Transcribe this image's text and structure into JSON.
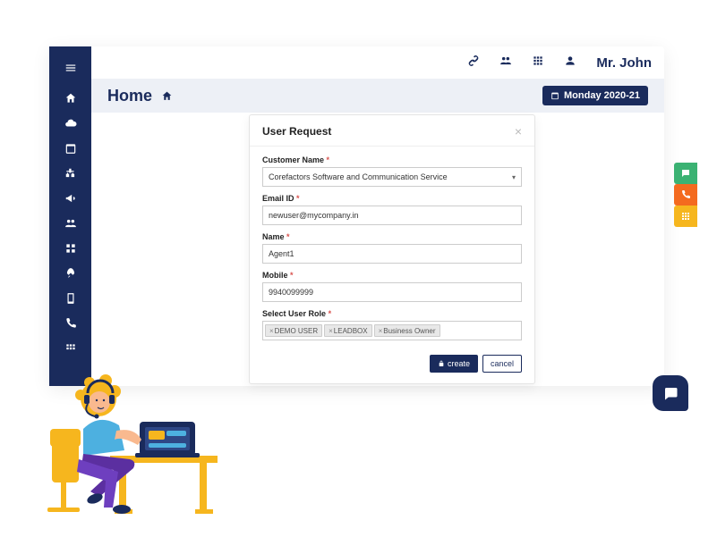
{
  "topbar": {
    "username": "Mr. John"
  },
  "subhead": {
    "title": "Home",
    "period": "Monday 2020-21"
  },
  "modal": {
    "title": "User Request",
    "customer_label": "Customer Name",
    "customer_value": "Corefactors Software and Communication Service",
    "email_label": "Email ID",
    "email_value": "newuser@mycompany.in",
    "name_label": "Name",
    "name_value": "Agent1",
    "mobile_label": "Mobile",
    "mobile_value": "9940099999",
    "role_label": "Select User Role",
    "role_tags": [
      "DEMO USER",
      "LEADBOX",
      "Business Owner"
    ],
    "create_btn": "create",
    "cancel_btn": "cancel"
  },
  "colors": {
    "primary": "#1a2b5c",
    "floater_green": "#3bb273",
    "floater_orange": "#f46a1f",
    "floater_yellow": "#f6b61e"
  }
}
